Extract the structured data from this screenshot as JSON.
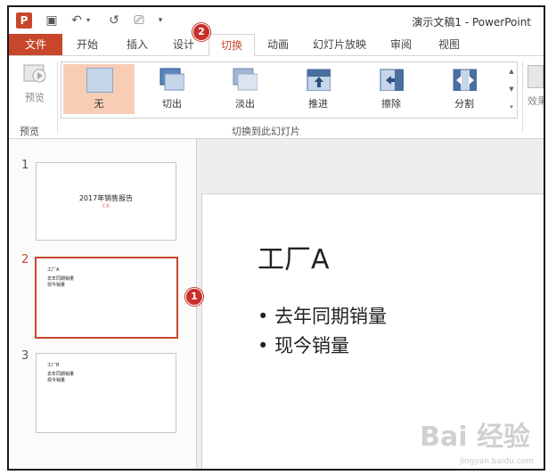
{
  "app": {
    "title": "演示文稿1 - PowerPoint",
    "logo": "P"
  },
  "quick_access": [
    {
      "name": "save-icon",
      "glyph": "▣"
    },
    {
      "name": "undo-icon",
      "glyph": "↶"
    },
    {
      "name": "redo-icon",
      "glyph": "↺"
    },
    {
      "name": "start-slideshow-icon",
      "glyph": "⎚"
    },
    {
      "name": "customize-icon",
      "glyph": "▾"
    }
  ],
  "tabs": [
    {
      "label": "文件"
    },
    {
      "label": "开始"
    },
    {
      "label": "插入"
    },
    {
      "label": "设计"
    },
    {
      "label": "切换"
    },
    {
      "label": "动画"
    },
    {
      "label": "幻灯片放映"
    },
    {
      "label": "审阅"
    },
    {
      "label": "视图"
    }
  ],
  "badges": {
    "two": "2",
    "one": "1"
  },
  "ribbon": {
    "preview_label": "预览",
    "preview_group": "预览",
    "transitions_group": "切换到此幻灯片",
    "effects_label": "效果",
    "gallery": [
      {
        "label": "无"
      },
      {
        "label": "切出"
      },
      {
        "label": "淡出"
      },
      {
        "label": "推进"
      },
      {
        "label": "擦除"
      },
      {
        "label": "分割"
      }
    ]
  },
  "slides": [
    {
      "num": "1",
      "title": "2017年销售报告",
      "subtitle": "汇总"
    },
    {
      "num": "2",
      "title": "工厂A",
      "bullets": [
        "去年同期销量",
        "现今销量"
      ]
    },
    {
      "num": "3",
      "title": "工厂B",
      "bullets": [
        "去年同期销量",
        "现今销量"
      ]
    }
  ],
  "current_slide": {
    "title": "工厂A",
    "bullets": [
      "去年同期销量",
      "现今销量"
    ]
  },
  "watermark": {
    "brand": "Bai 经验",
    "url": "jingyan.baidu.com"
  },
  "colors": {
    "accent": "#c8472c",
    "selected_bg": "#f8cdb5"
  }
}
